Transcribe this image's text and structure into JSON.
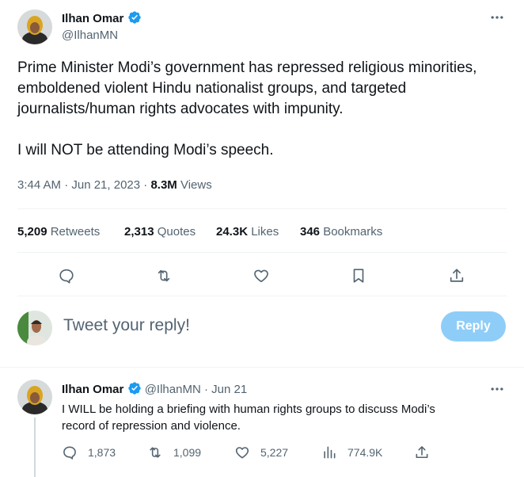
{
  "main_tweet": {
    "author_name": "Ilhan Omar",
    "handle": "@IlhanMN",
    "text_lines": [
      "Prime Minister Modi’s government has repressed religious minorities,",
      "emboldened violent Hindu nationalist groups, and targeted",
      "journalists/human rights advocates with impunity."
    ],
    "text_line_4": "I will NOT be attending Modi’s speech.",
    "time_date": "3:44 AM · Jun 21, 2023 · ",
    "views_count": "8.3M",
    "views_label": " Views"
  },
  "stats": {
    "retweets_count": "5,209",
    "retweets_label": " Retweets",
    "quotes_count": "2,313",
    "quotes_label": " Quotes",
    "likes_count": "24.3K",
    "likes_label": " Likes",
    "bookmarks_count": "346",
    "bookmarks_label": " Bookmarks"
  },
  "reply_box": {
    "placeholder": "Tweet your reply!",
    "button_label": "Reply"
  },
  "thread_reply": {
    "author_name": "Ilhan Omar",
    "handle": "@IlhanMN",
    "separator": " · ",
    "date": "Jun 21",
    "text_line_1": "I WILL be holding a briefing with human rights groups to discuss Modi’s",
    "text_line_2": "record of repression and violence.",
    "reply_count": "1,873",
    "retweet_count": "1,099",
    "like_count": "5,227",
    "views_count": "774.9K"
  },
  "colors": {
    "verified": "#1d9bf0",
    "reply_button": "#8ecdf8",
    "muted": "#536471"
  }
}
